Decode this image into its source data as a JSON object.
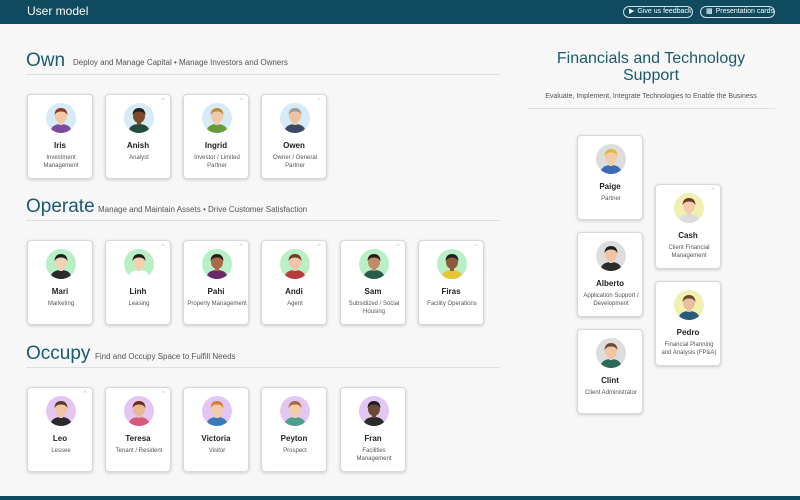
{
  "header": {
    "title": "User model",
    "feedback_label": "Give us feedback",
    "feedback_icon": "megaphone-icon",
    "present_label": "Presentation cards",
    "present_icon": "cards-icon"
  },
  "sections": {
    "own": {
      "title": "Own",
      "subtitle": "Deploy and Manage Capital • Manage Investors and Owners",
      "cards": [
        {
          "name": "Iris",
          "role": "Investment Management",
          "bg": "#d6ebf5",
          "skin": "#f2c7a5",
          "hair": "#8a3a2a",
          "shirt": "#7b4aa0",
          "pin": false
        },
        {
          "name": "Anish",
          "role": "Analyst",
          "bg": "#d6ebf5",
          "skin": "#7a4a2a",
          "hair": "#1e1e1e",
          "shirt": "#234d3a",
          "pin": true
        },
        {
          "name": "Ingrid",
          "role": "Investor / Limited Partner",
          "bg": "#d6ebf5",
          "skin": "#f0c9a8",
          "hair": "#c08a3e",
          "shirt": "#6a9a3a",
          "pin": true
        },
        {
          "name": "Owen",
          "role": "Owner / General Partner",
          "bg": "#d6ebf5",
          "skin": "#ecc4a4",
          "hair": "#9a9a9a",
          "shirt": "#3a4a66",
          "pin": true
        }
      ]
    },
    "operate": {
      "title": "Operate",
      "subtitle": "Manage and Maintain Assets • Drive Customer Satisfaction",
      "cards": [
        {
          "name": "Mari",
          "role": "Marketing",
          "bg": "#b8efc4",
          "skin": "#f2d2b4",
          "hair": "#1e1e1e",
          "shirt": "#2a2a2a",
          "pin": false
        },
        {
          "name": "Linh",
          "role": "Leasing",
          "bg": "#b8efc4",
          "skin": "#f2d0b0",
          "hair": "#1e1e1e",
          "shirt": "#ffffff",
          "pin": true
        },
        {
          "name": "Pahi",
          "role": "Property Management",
          "bg": "#b8efc4",
          "skin": "#a86a48",
          "hair": "#2a1a12",
          "shirt": "#6a2a6a",
          "pin": true
        },
        {
          "name": "Andi",
          "role": "Agent",
          "bg": "#b8efc4",
          "skin": "#f0c4a4",
          "hair": "#6a3a22",
          "shirt": "#b83a3a",
          "pin": true
        },
        {
          "name": "Sam",
          "role": "Subsidized / Social Housing",
          "bg": "#b8efc4",
          "skin": "#c08a64",
          "hair": "#2a1a12",
          "shirt": "#2a5a4a",
          "pin": true
        },
        {
          "name": "Firas",
          "role": "Facility Operations",
          "bg": "#b8efc4",
          "skin": "#8a5a3a",
          "hair": "#1e1e1e",
          "shirt": "#e8c43a",
          "pin": true
        }
      ]
    },
    "occupy": {
      "title": "Occupy",
      "subtitle": "Find and Occupy Space to Fulfill Needs",
      "cards": [
        {
          "name": "Leo",
          "role": "Lessee",
          "bg": "#e3c6f2",
          "skin": "#f0c4a4",
          "hair": "#5a3a22",
          "shirt": "#2a2a2a",
          "pin": true
        },
        {
          "name": "Teresa",
          "role": "Tenant / Resident",
          "bg": "#e3c6f2",
          "skin": "#e8b894",
          "hair": "#6a2a1a",
          "shirt": "#d85a7a",
          "pin": true
        },
        {
          "name": "Victoria",
          "role": "Visitor",
          "bg": "#e3c6f2",
          "skin": "#f2cca8",
          "hair": "#d87a3a",
          "shirt": "#3a7ab8",
          "pin": false
        },
        {
          "name": "Peyton",
          "role": "Prospect",
          "bg": "#e3c6f2",
          "skin": "#f2cca8",
          "hair": "#a86a3a",
          "shirt": "#4aa08a",
          "pin": false
        },
        {
          "name": "Fran",
          "role": "Facilities Management",
          "bg": "#e3c6f2",
          "skin": "#6a4a32",
          "hair": "#1e1e1e",
          "shirt": "#2a2a2a",
          "pin": false
        }
      ]
    }
  },
  "financials": {
    "title": "Financials and Technology Support",
    "subtitle": "Evaluate, Implement, Integrate Technologies to Enable the Business",
    "cards": [
      {
        "name": "Paige",
        "role": "Partner",
        "bg": "#dddddd",
        "skin": "#f2cca8",
        "hair": "#e0b83a",
        "shirt": "#3a6ab8",
        "pin": false
      },
      {
        "name": "Cash",
        "role": "Client Financial Management",
        "bg": "#f0f0b0",
        "skin": "#f2cca8",
        "hair": "#6a3a22",
        "shirt": "#dcdcdc",
        "pin": true
      },
      {
        "name": "Alberto",
        "role": "Application Support / Development",
        "bg": "#dddddd",
        "skin": "#f0c4a4",
        "hair": "#1e1e1e",
        "shirt": "#2a2a2a",
        "pin": false
      },
      {
        "name": "Pedro",
        "role": "Financial Planning and Analysis (FP&A)",
        "bg": "#f0f0b0",
        "skin": "#e8c0a0",
        "hair": "#6a4a2a",
        "shirt": "#2a5a7a",
        "pin": false
      },
      {
        "name": "Clint",
        "role": "Client Administrator",
        "bg": "#dddddd",
        "skin": "#f0c4a4",
        "hair": "#6a4a32",
        "shirt": "#2a6a5a",
        "pin": false
      }
    ]
  },
  "icons": {
    "pin": "pin-icon"
  }
}
